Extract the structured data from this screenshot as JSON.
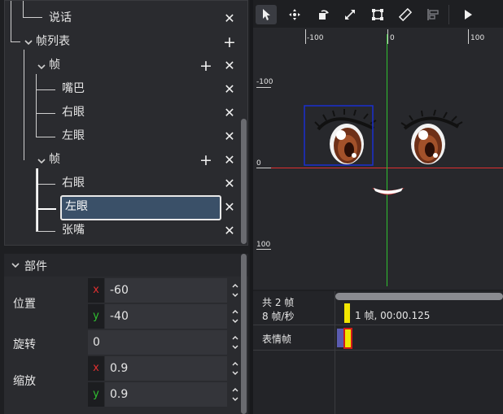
{
  "tree": {
    "items": [
      {
        "label": "说话"
      },
      {
        "label": "帧列表"
      },
      {
        "label": "帧"
      },
      {
        "label": "嘴巴"
      },
      {
        "label": "右眼"
      },
      {
        "label": "左眼"
      },
      {
        "label": "帧"
      },
      {
        "label": "右眼"
      },
      {
        "label": "左眼",
        "selected": true
      },
      {
        "label": "张嘴"
      }
    ],
    "close_glyph": "✕",
    "add_glyph": "+"
  },
  "properties": {
    "header": "部件",
    "position": {
      "label": "位置",
      "x": "-60",
      "y": "-40"
    },
    "rotation": {
      "label": "旋转",
      "value": "0"
    },
    "scale": {
      "label": "缩放",
      "x": "0.9",
      "y": "0.9"
    },
    "axis_x": "x",
    "axis_y": "y"
  },
  "toolbar": {
    "tools": [
      "select-arrow-icon",
      "move-icon",
      "rotate-icon",
      "resize-icon",
      "crop-frame-icon",
      "ruler-icon",
      "align-icon",
      "play-icon"
    ]
  },
  "canvas": {
    "ruler_top": [
      "-100",
      "0",
      "100"
    ],
    "ruler_left": [
      "-100",
      "0",
      "100"
    ]
  },
  "timeline": {
    "total_frames": "共 2 帧",
    "fps": "8 帧/秒",
    "current_frame_info": "1 帧, 00:00.125",
    "track_label": "表情帧"
  },
  "colors": {
    "selection_fill": "#3a5068",
    "axis_x": "#e03030",
    "axis_y": "#30c030",
    "keyframe": "#f2e600"
  }
}
